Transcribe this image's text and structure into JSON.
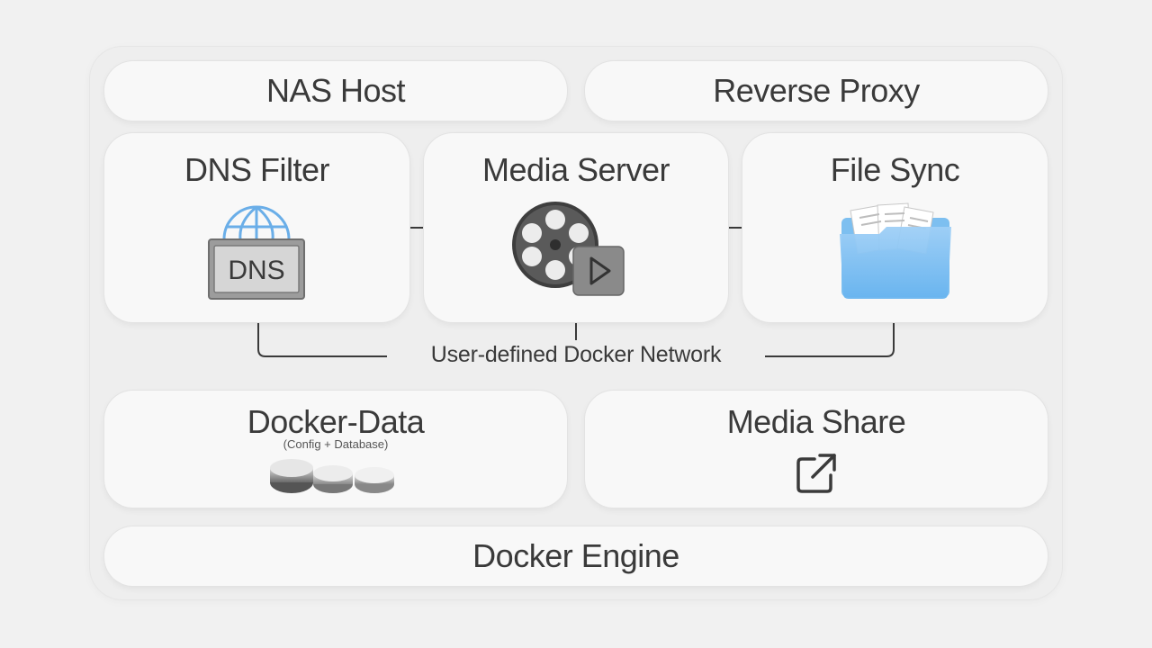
{
  "diagram": {
    "top_boxes": {
      "nas_host": "NAS Host",
      "reverse_proxy": "Reverse Proxy"
    },
    "services": {
      "dns_filter": {
        "title": "DNS Filter",
        "icon": "globe-dns-icon",
        "icon_text": "DNS"
      },
      "media_server": {
        "title": "Media Server",
        "icon": "film-reel-play-icon"
      },
      "file_sync": {
        "title": "File Sync",
        "icon": "folder-documents-icon"
      }
    },
    "network_label": "User-defined Docker Network",
    "storage": {
      "docker_data": {
        "title": "Docker-Data",
        "subtitle": "(Config + Database)",
        "icon": "database-disks-icon"
      },
      "media_share": {
        "title": "Media Share",
        "icon": "external-link-icon"
      }
    },
    "engine": "Docker Engine"
  }
}
